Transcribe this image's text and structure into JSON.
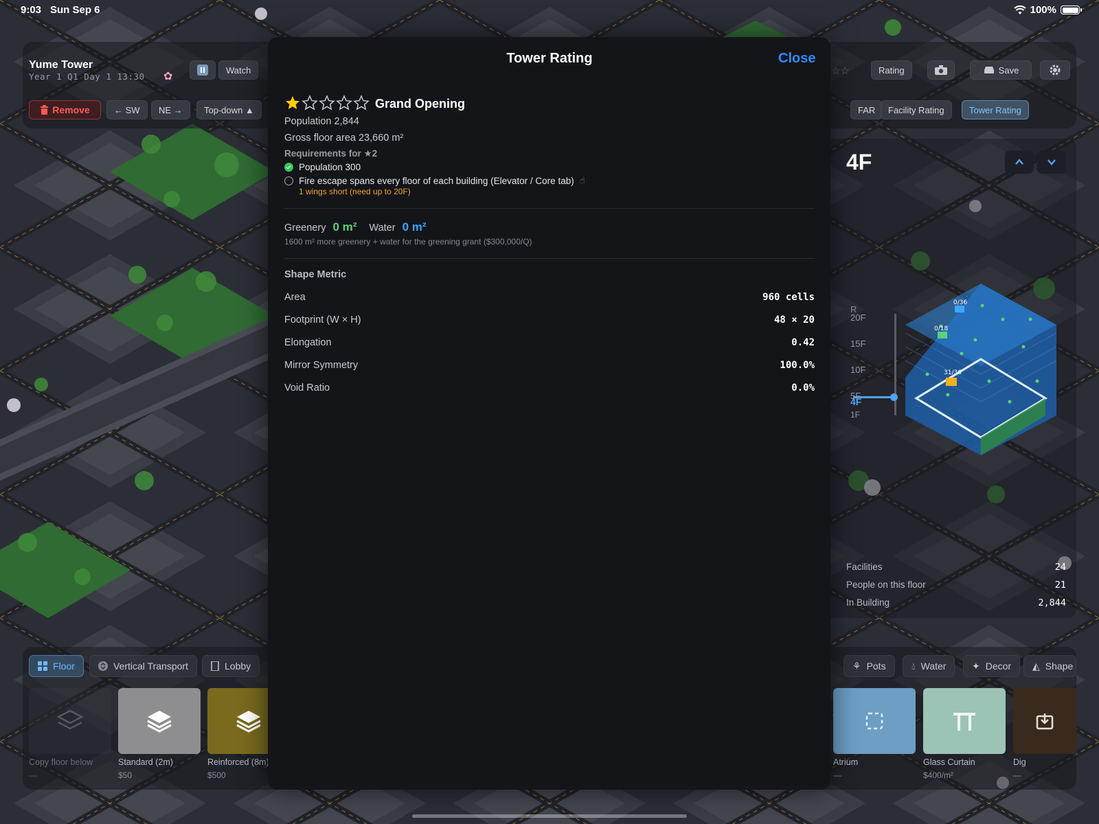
{
  "status_bar": {
    "time": "9:03",
    "date": "Sun Sep 6",
    "battery": "100%"
  },
  "hud": {
    "tower_name": "Yume Tower",
    "date_line": "Year 1  Q1 Day 1  13:30",
    "watch_label": "Watch",
    "remove_label": "Remove",
    "rotate_sw_label": "← SW",
    "rotate_ne_label": "NE →",
    "view_label": "Top-down ▲",
    "rating_label": "Rating",
    "save_label": "Save",
    "far_label": "FAR",
    "facility_rating_label": "Facility Rating",
    "tower_rating_label": "Tower Rating"
  },
  "floor_panel": {
    "current_floor": "4F",
    "floor_marks": [
      "R",
      "20F",
      "15F",
      "10F",
      "5F",
      "4F",
      "1F"
    ],
    "stats": [
      {
        "label": "Facilities",
        "value": "24"
      },
      {
        "label": "People on this floor",
        "value": "21"
      },
      {
        "label": "In Building",
        "value": "2,844"
      }
    ],
    "room_badges": [
      "0/36",
      "0/18",
      "31/36"
    ]
  },
  "toolbar": {
    "tabs_left": [
      "Floor",
      "Vertical Transport",
      "Lobby"
    ],
    "tabs_right": [
      "Pots",
      "Water",
      "Decor",
      "Shape"
    ],
    "tiles_left": [
      {
        "name": "Copy floor below",
        "price": "—"
      },
      {
        "name": "Standard (2m)",
        "price": "$50"
      },
      {
        "name": "Reinforced (8m)",
        "price": "$500"
      }
    ],
    "tiles_right": [
      {
        "name": "Atrium",
        "price": "—"
      },
      {
        "name": "Glass Curtain",
        "price": "$400/m²"
      },
      {
        "name": "Dig",
        "price": "—"
      }
    ]
  },
  "modal": {
    "title": "Tower Rating",
    "close_label": "Close",
    "stars_filled": 1,
    "stars_total": 5,
    "rating_name": "Grand Opening",
    "population": "Population 2,844",
    "gross_floor_area": "Gross floor area 23,660 m²",
    "requirements_title": "Requirements for ★2",
    "requirements": [
      {
        "text": "Population 300",
        "met": true
      },
      {
        "text": "Fire escape spans every floor of each building (Elevator / Core tab)",
        "met": false
      }
    ],
    "requirement_warning": "1 wings short (need up to 20F)",
    "greenery_label": "Greenery",
    "greenery_value": "0 m²",
    "water_label": "Water",
    "water_value": "0 m²",
    "grant_note": "1600 m² more greenery + water for the greening grant ($300,000/Q)",
    "shape_title": "Shape Metric",
    "metrics": [
      {
        "label": "Area",
        "value": "960 cells"
      },
      {
        "label": "Footprint (W × H)",
        "value": "48 × 20"
      },
      {
        "label": "Elongation",
        "value": "0.42"
      },
      {
        "label": "Mirror Symmetry",
        "value": "100.0%"
      },
      {
        "label": "Void Ratio",
        "value": "0.0%"
      }
    ]
  },
  "colors": {
    "accent": "#2f8bff",
    "star": "#ffcc00",
    "ok": "#34c759",
    "warn": "#f0a030",
    "greenery": "#5dd07a",
    "water": "#3ea6ff"
  }
}
